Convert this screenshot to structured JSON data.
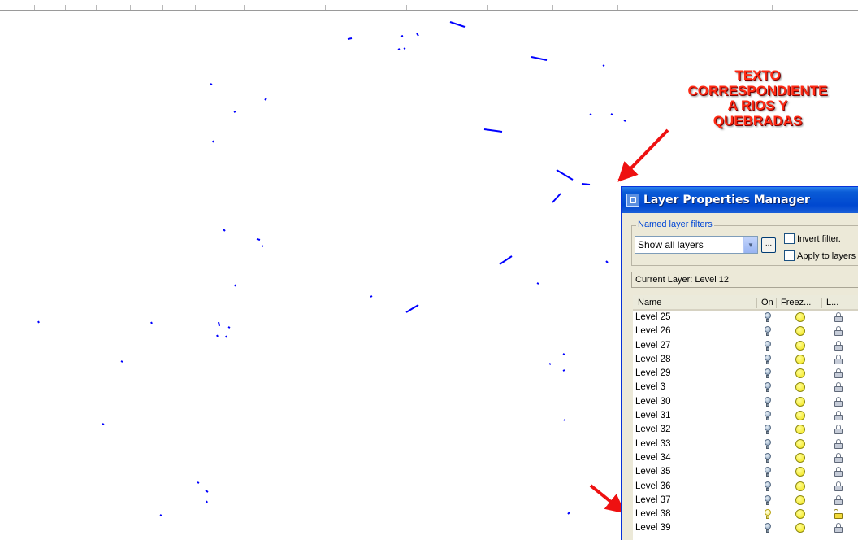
{
  "annotation": {
    "lines": [
      "TEXTO",
      "CORRESPONDIENTE",
      "A RIOS Y",
      "QUEBRADAS"
    ]
  },
  "dialog": {
    "title": "Layer Properties Manager",
    "filters": {
      "group_label": "Named layer filters",
      "selected": "Show all layers",
      "more_button": "...",
      "invert_label": "Invert filter.",
      "apply_label": "Apply to layers"
    },
    "current_layer_label": "Current Layer:",
    "current_layer_value": "Level 12",
    "columns": [
      "Name",
      "On",
      "Freez...",
      "L..."
    ],
    "layers": [
      {
        "name": "Level 25",
        "on": false,
        "unlocked": false
      },
      {
        "name": "Level 26",
        "on": false,
        "unlocked": false
      },
      {
        "name": "Level 27",
        "on": false,
        "unlocked": false
      },
      {
        "name": "Level 28",
        "on": false,
        "unlocked": false
      },
      {
        "name": "Level 29",
        "on": false,
        "unlocked": false
      },
      {
        "name": "Level 3",
        "on": false,
        "unlocked": false
      },
      {
        "name": "Level 30",
        "on": false,
        "unlocked": false
      },
      {
        "name": "Level 31",
        "on": false,
        "unlocked": false
      },
      {
        "name": "Level 32",
        "on": false,
        "unlocked": false
      },
      {
        "name": "Level 33",
        "on": false,
        "unlocked": false
      },
      {
        "name": "Level 34",
        "on": false,
        "unlocked": false
      },
      {
        "name": "Level 35",
        "on": false,
        "unlocked": false
      },
      {
        "name": "Level 36",
        "on": false,
        "unlocked": false
      },
      {
        "name": "Level 37",
        "on": false,
        "unlocked": false
      },
      {
        "name": "Level 38",
        "on": true,
        "unlocked": true
      },
      {
        "name": "Level 39",
        "on": false,
        "unlocked": false
      }
    ]
  },
  "colors": {
    "drawing_stroke": "#0000ff",
    "annotation_text": "#ff2a14",
    "arrow": "#ee1111",
    "titlebar": "#0a5bd6"
  },
  "icons": [
    "light-bulb-icon",
    "freeze-sun-icon",
    "lock-icon",
    "red-arrow-icon",
    "app-icon",
    "checkbox-icon",
    "dropdown-arrow-icon"
  ]
}
